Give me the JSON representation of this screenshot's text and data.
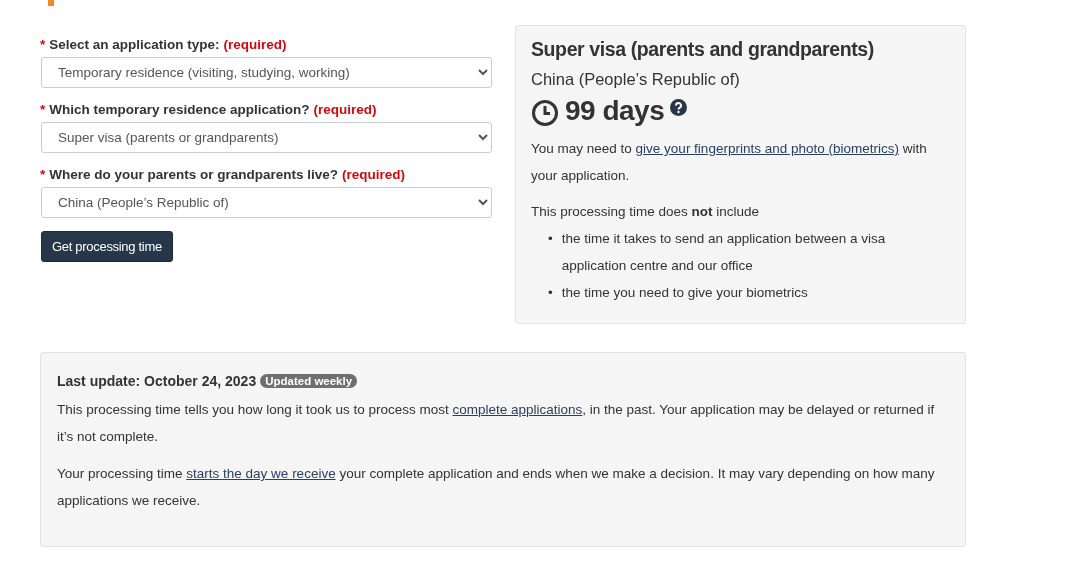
{
  "form": {
    "fields": [
      {
        "marker": "*",
        "label": "Select an application type:",
        "required_text": "(required)",
        "value": "Temporary residence (visiting, studying, working)"
      },
      {
        "marker": "*",
        "label": "Which temporary residence application?",
        "required_text": "(required)",
        "value": "Super visa (parents or grandparents)"
      },
      {
        "marker": "*",
        "label": "Where do your parents or grandparents live?",
        "required_text": "(required)",
        "value": "China (People’s Republic of)"
      }
    ],
    "button": "Get processing time"
  },
  "result": {
    "title": "Super visa (parents and grandparents)",
    "country": "China (People’s Republic of)",
    "time": "99 days",
    "biometrics_note": [
      {
        "text": "You may need to "
      },
      {
        "link": "give your fingerprints and photo (biometrics)"
      },
      {
        "text": " with your application."
      }
    ],
    "exclusions_intro": "This processing time does **not** include",
    "exclusions": [
      {
        "bullet": "•",
        "text": "the time it takes to send an application between a visa application centre and our office"
      },
      {
        "bullet": "•",
        "text": "the time you need to give your biometrics"
      }
    ]
  },
  "update": {
    "label": "Last update: October 24, 2023",
    "badge": "Updated weekly",
    "paragraphs": [
      [
        {
          "text": "This processing time tells you how long it took us to process most "
        },
        {
          "link": "complete applications"
        },
        {
          "text": ", in the past. Your application may be delayed or returned if it’s not complete."
        }
      ],
      [
        {
          "text": "Your processing time "
        },
        {
          "link": "starts the day we receive"
        },
        {
          "text": " your complete application and ends when we make a decision. It may vary depending on how many applications we receive."
        }
      ]
    ]
  }
}
